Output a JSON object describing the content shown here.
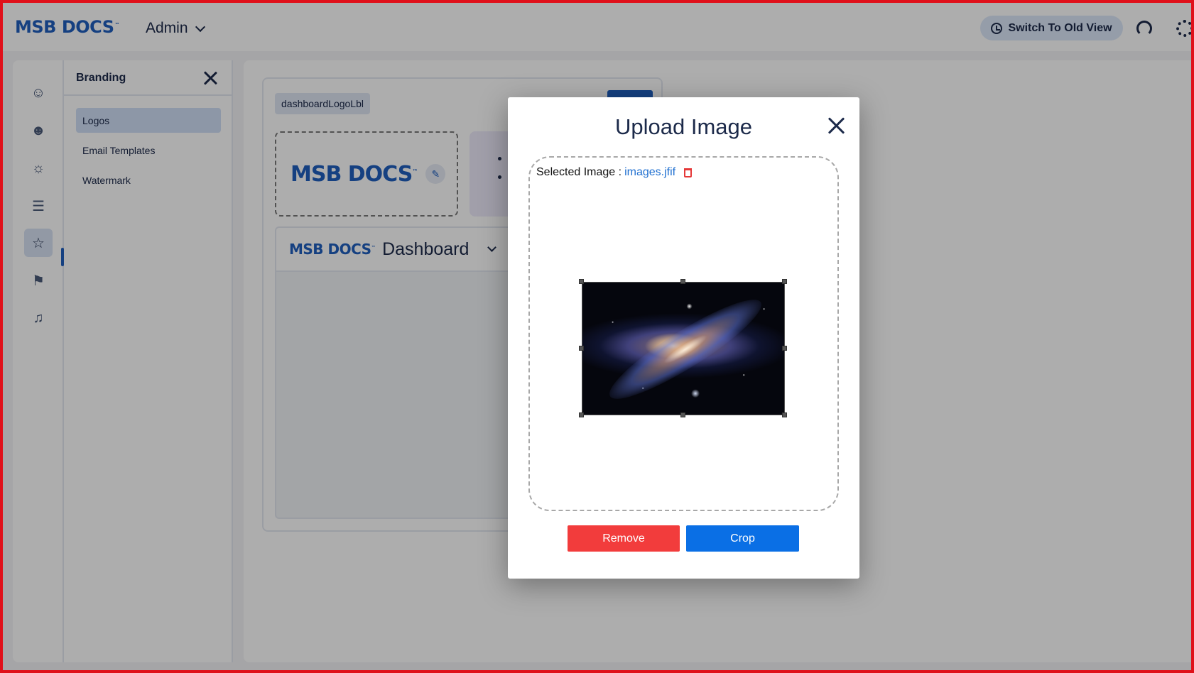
{
  "header": {
    "brand": "MSB DOCS",
    "brand_tm": "™",
    "role": "Admin",
    "switch_view_label": "Switch To Old View"
  },
  "branding_panel": {
    "title": "Branding",
    "items": [
      {
        "label": "Logos",
        "active": true
      },
      {
        "label": "Email Templates",
        "active": false
      },
      {
        "label": "Watermark",
        "active": false
      }
    ]
  },
  "main": {
    "chip_label": "dashboardLogoLbl",
    "logo_text": "MSB DOCS",
    "logo_tm": "™",
    "preview_logo": "MSB DOCS",
    "preview_tm": "™",
    "preview_title": "Dashboard"
  },
  "modal": {
    "title": "Upload Image",
    "selected_label": "Selected Image :",
    "file_name": "images.jfif",
    "remove_label": "Remove",
    "crop_label": "Crop"
  },
  "colors": {
    "brand_blue": "#1f5fbf",
    "remove_red": "#f23c3c",
    "crop_blue": "#0a6fe5"
  }
}
